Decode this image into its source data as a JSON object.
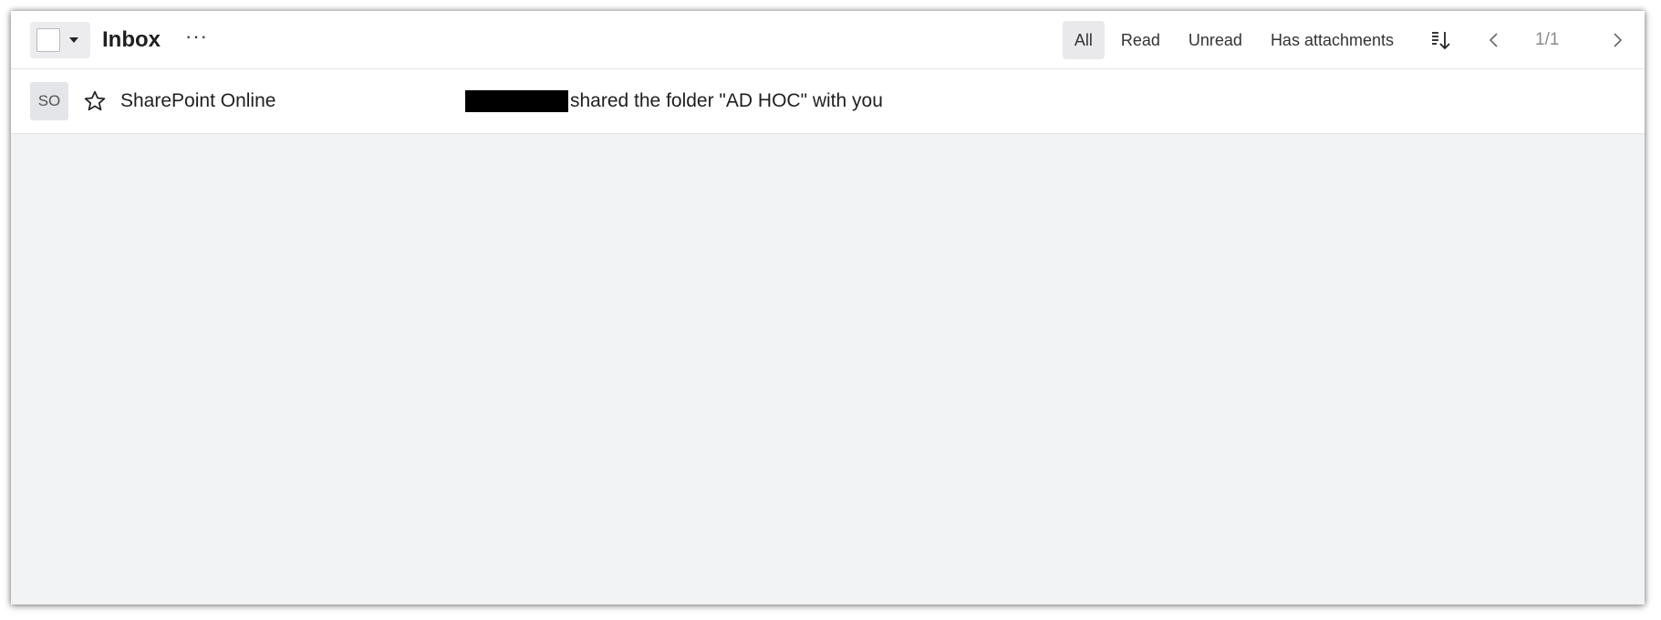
{
  "header": {
    "title": "Inbox",
    "more_label": "···",
    "filters": [
      "All",
      "Read",
      "Unread",
      "Has attachments"
    ],
    "active_filter": "All",
    "pagination": "1/1"
  },
  "icons": {
    "select_caret": "chevron-down-icon",
    "more": "more-icon",
    "sort": "sort-icon",
    "prev": "chevron-left-icon",
    "next": "chevron-right-icon",
    "star": "star-icon"
  },
  "messages": [
    {
      "avatar": "SO",
      "sender": "SharePoint Online",
      "subject": "shared the folder \"AD HOC\" with you",
      "starred": false
    }
  ]
}
